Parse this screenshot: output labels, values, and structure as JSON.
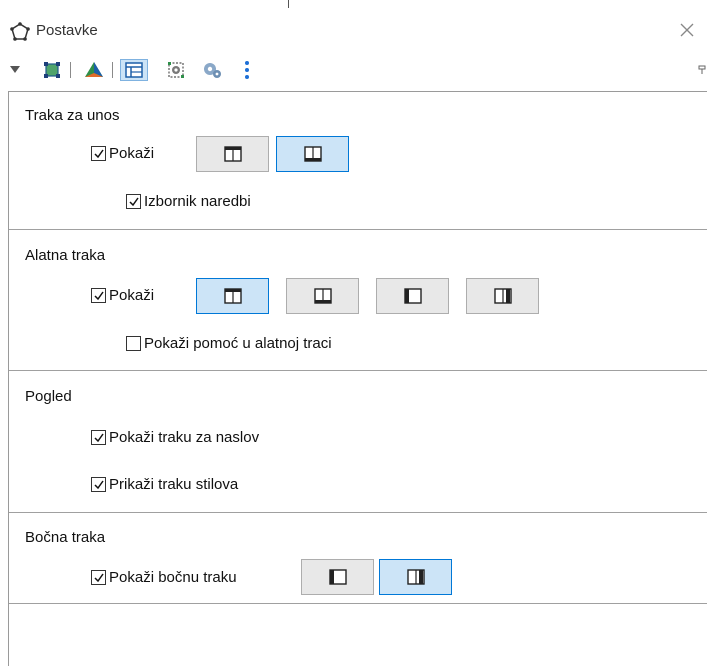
{
  "window": {
    "title": "Postavke",
    "title_icon": "polygon-icon",
    "close_icon": "close-icon"
  },
  "toolbar": {
    "items": [
      {
        "icon": "dropdown-triangle-icon"
      },
      {
        "icon": "polygon-tool-icon"
      },
      {
        "icon": "graphics-3d-icon"
      },
      {
        "icon": "layout-icon",
        "selected": true
      },
      {
        "icon": "defaults-icon"
      },
      {
        "icon": "advanced-settings-icon"
      },
      {
        "icon": "more-options-icon"
      }
    ]
  },
  "sections": {
    "input_bar": {
      "title": "Traka za unos",
      "show": {
        "label": "Pokaži",
        "checked": true
      },
      "command_menu": {
        "label": "Izbornik naredbi",
        "checked": true
      },
      "positions": [
        "top",
        "bottom"
      ],
      "selected": 1
    },
    "toolbar": {
      "title": "Alatna traka",
      "show": {
        "label": "Pokaži",
        "checked": true
      },
      "help": {
        "label": "Pokaži pomoć u alatnoj traci",
        "checked": false
      },
      "positions": [
        "top",
        "bottom",
        "left",
        "right"
      ],
      "selected": 0
    },
    "view": {
      "title": "Pogled",
      "title_bar": {
        "label": "Pokaži traku za naslov",
        "checked": true
      },
      "style_bar": {
        "label": "Prikaži traku stilova",
        "checked": true
      }
    },
    "sidebar": {
      "title": "Bočna traka",
      "show": {
        "label": "Pokaži bočnu traku",
        "checked": true
      },
      "positions": [
        "left",
        "right"
      ],
      "selected": 1
    }
  }
}
